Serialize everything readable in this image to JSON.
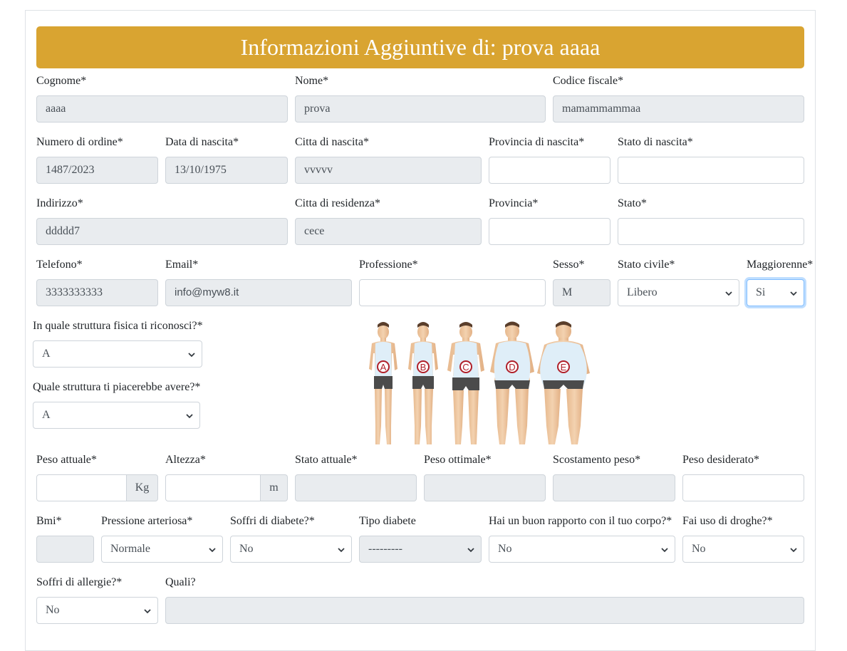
{
  "header": {
    "title": "Informazioni Aggiuntive di: prova aaaa"
  },
  "row1": {
    "cognome": {
      "label": "Cognome*",
      "value": "aaaa"
    },
    "nome": {
      "label": "Nome*",
      "value": "prova"
    },
    "codice_fiscale": {
      "label": "Codice fiscale*",
      "value": "mamammammaa"
    }
  },
  "row2": {
    "numero_ordine": {
      "label": "Numero di ordine*",
      "value": "1487/2023"
    },
    "data_nascita": {
      "label": "Data di nascita*",
      "value": "13/10/1975"
    },
    "citta_nascita": {
      "label": "Citta di nascita*",
      "value": "vvvvv"
    },
    "provincia_nascita": {
      "label": "Provincia di nascita*",
      "value": ""
    },
    "stato_nascita": {
      "label": "Stato di nascita*",
      "value": ""
    }
  },
  "row3": {
    "indirizzo": {
      "label": "Indirizzo*",
      "value": "ddddd7"
    },
    "citta_residenza": {
      "label": "Citta di residenza*",
      "value": "cece"
    },
    "provincia": {
      "label": "Provincia*",
      "value": ""
    },
    "stato": {
      "label": "Stato*",
      "value": ""
    }
  },
  "row4": {
    "telefono": {
      "label": "Telefono*",
      "value": "3333333333"
    },
    "email": {
      "label": "Email*",
      "value": "info@myw8.it"
    },
    "professione": {
      "label": "Professione*",
      "value": ""
    },
    "sesso": {
      "label": "Sesso*",
      "value": "M"
    },
    "stato_civile": {
      "label": "Stato civile*",
      "value": "Libero"
    },
    "maggiorenne": {
      "label": "Maggiorenne*",
      "value": "Si"
    }
  },
  "struttura": {
    "attuale": {
      "label": "In quale struttura fisica ti riconosci?*",
      "value": "A"
    },
    "desiderata": {
      "label": "Quale struttura ti piacerebbe avere?*",
      "value": "A"
    },
    "bodies": [
      "A",
      "B",
      "C",
      "D",
      "E"
    ]
  },
  "row5": {
    "peso_attuale": {
      "label": "Peso attuale*",
      "value": "",
      "unit": "Kg"
    },
    "altezza": {
      "label": "Altezza*",
      "value": "",
      "unit": "m"
    },
    "stato_attuale": {
      "label": "Stato attuale*",
      "value": ""
    },
    "peso_ottimale": {
      "label": "Peso ottimale*",
      "value": ""
    },
    "scostamento_peso": {
      "label": "Scostamento peso*",
      "value": ""
    },
    "peso_desiderato": {
      "label": "Peso desiderato*",
      "value": ""
    }
  },
  "row6": {
    "bmi": {
      "label": "Bmi*",
      "value": ""
    },
    "pressione": {
      "label": "Pressione arteriosa*",
      "value": "Normale"
    },
    "diabete": {
      "label": "Soffri di diabete?*",
      "value": "No"
    },
    "tipo_diabete": {
      "label": "Tipo diabete",
      "value": "---------"
    },
    "rapporto_corpo": {
      "label": "Hai un buon rapporto con il tuo corpo?*",
      "value": "No"
    },
    "droghe": {
      "label": "Fai uso di droghe?*",
      "value": "No"
    }
  },
  "row7": {
    "allergie": {
      "label": "Soffri di allergie?*",
      "value": "No"
    },
    "quali": {
      "label": "Quali?",
      "value": ""
    }
  },
  "colors": {
    "header": "#d9a431",
    "readonly_bg": "#e9ecef",
    "border": "#ced4da",
    "marker": "#b0202a"
  }
}
